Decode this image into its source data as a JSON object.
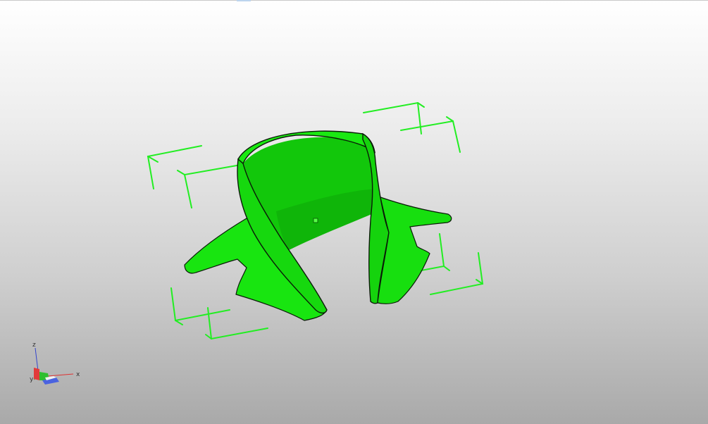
{
  "viewer": {
    "axis_labels": {
      "x": "x",
      "y": "y",
      "z": "z"
    }
  },
  "model": {
    "color": "#13dd0c",
    "shade_color": "#0fc40a",
    "edge_color": "#0a1a08",
    "selection_color": "#22ee22"
  },
  "triad_colors": {
    "x": "#dd3333",
    "y": "#22bb22",
    "z": "#3344cc"
  }
}
